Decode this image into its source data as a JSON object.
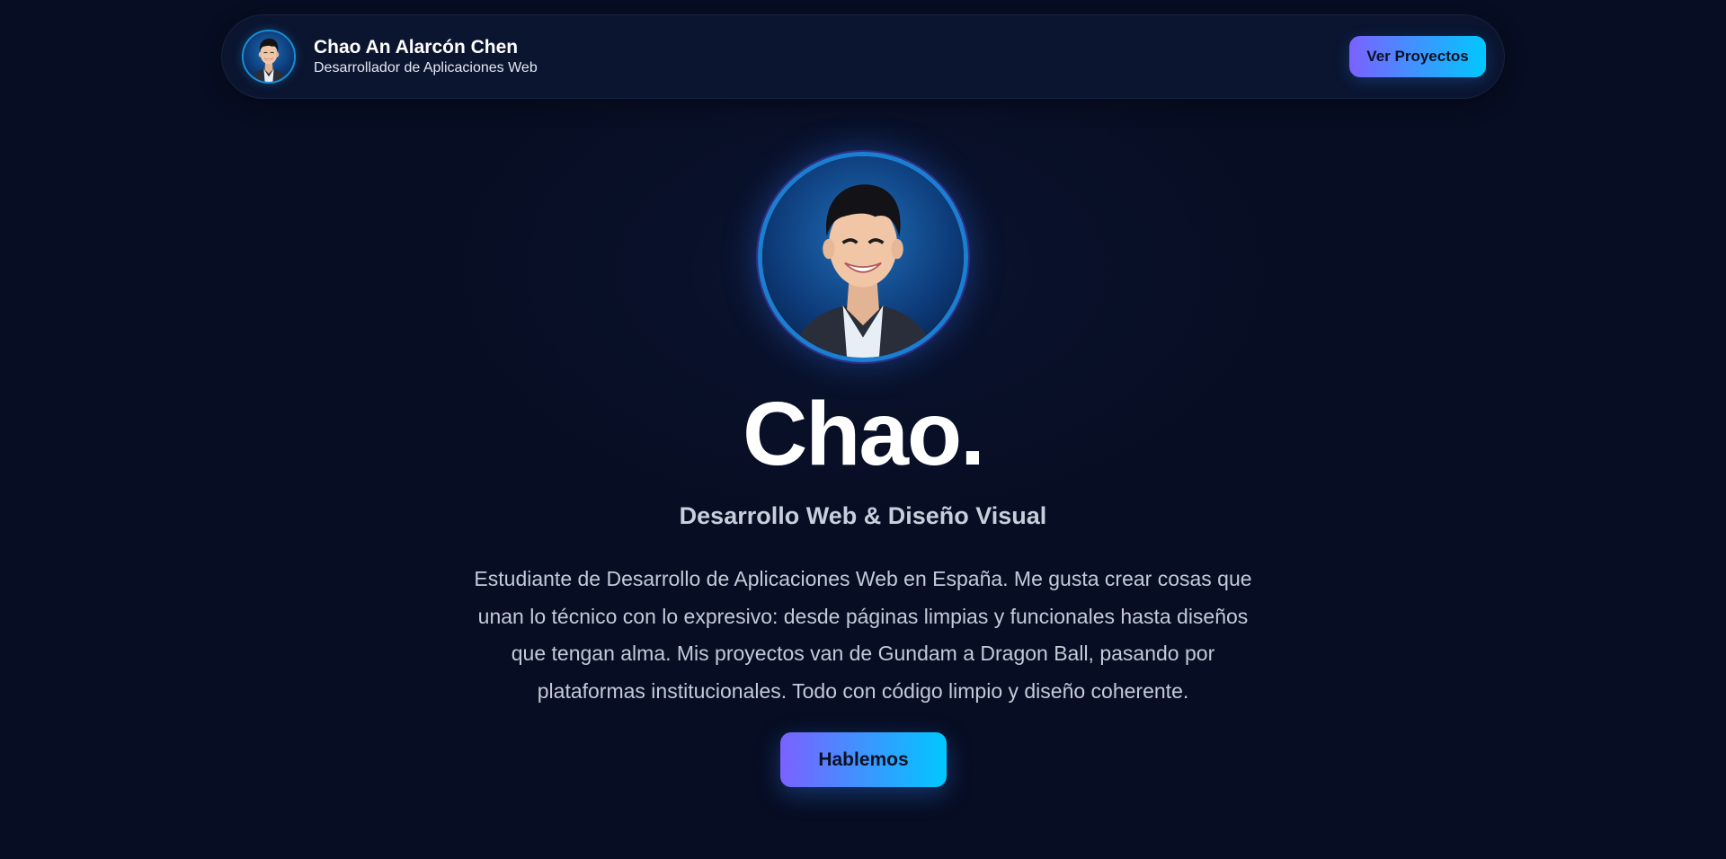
{
  "navbar": {
    "name": "Chao An Alarcón Chen",
    "role": "Desarrollador de Aplicaciones Web",
    "cta_label": "Ver Proyectos",
    "avatar_icon": "profile-photo"
  },
  "hero": {
    "title": "Chao.",
    "subtitle": "Desarrollo Web & Diseño Visual",
    "description": "Estudiante de Desarrollo de Aplicaciones Web en España. Me gusta crear cosas que unan lo técnico con lo expresivo: desde páginas limpias y funcionales hasta diseños que tengan alma. Mis proyectos van de Gundam a Dragon Ball, pasando por plataformas institucionales. Todo con código limpio y diseño coherente.",
    "cta_label": "Hablemos"
  },
  "colors": {
    "background": "#070d22",
    "navbar_bg": "#0b1530",
    "accent_start": "#7b61ff",
    "accent_end": "#00c8ff",
    "avatar_ring": "#1b7fd1"
  }
}
